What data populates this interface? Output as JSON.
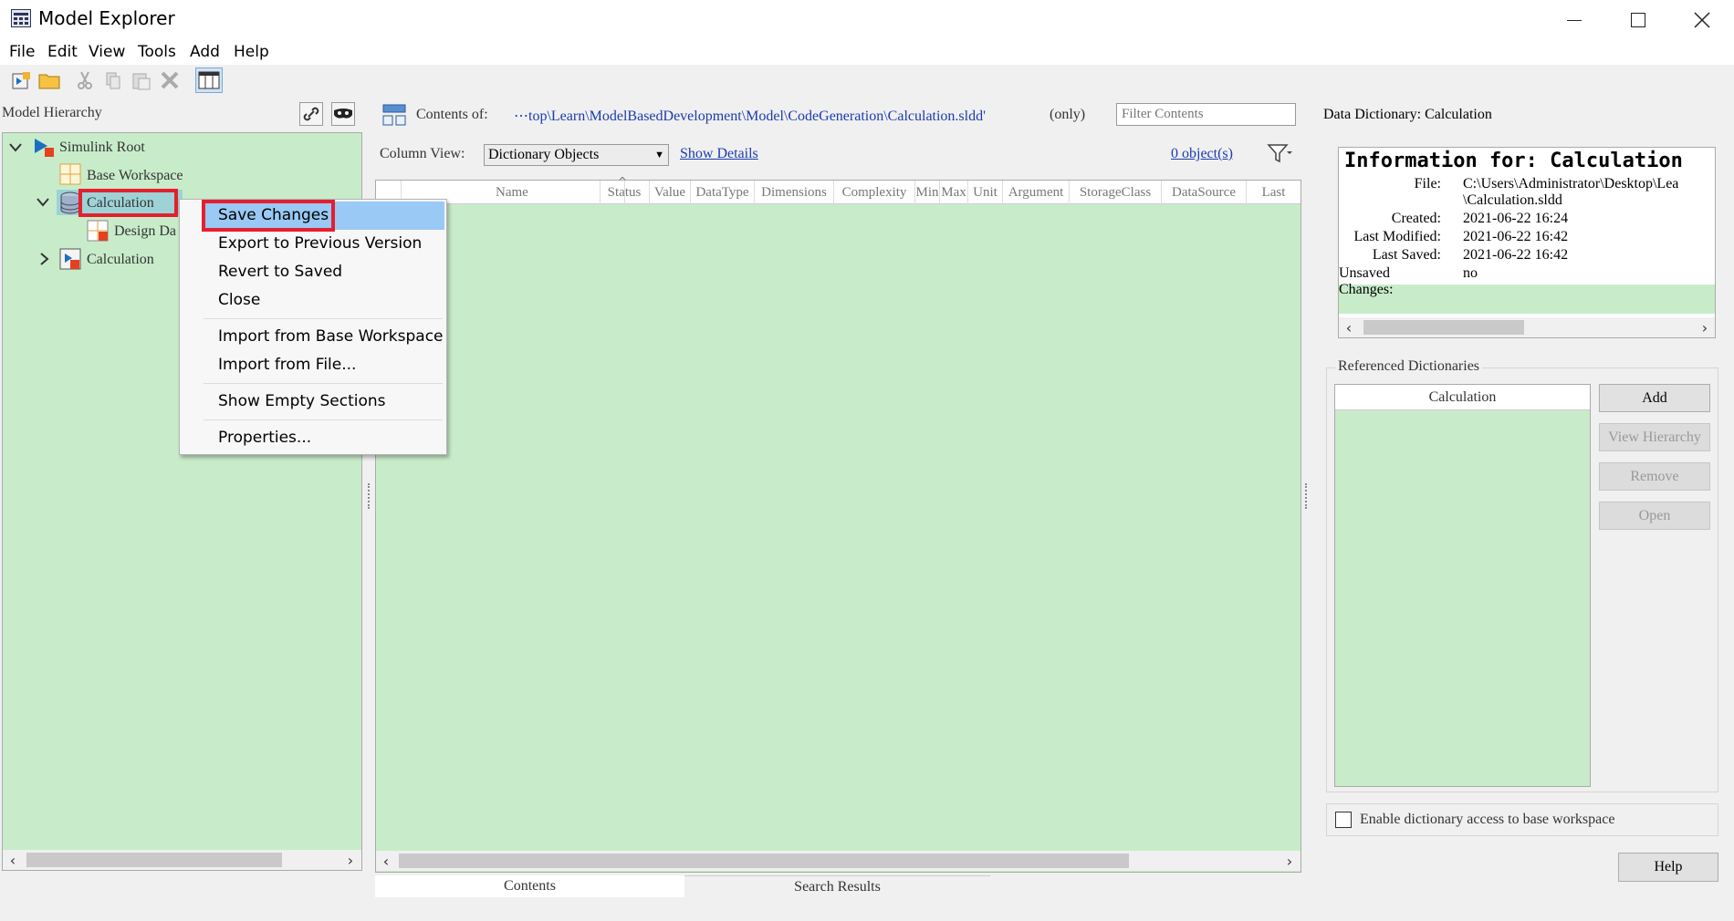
{
  "window": {
    "title": "Model Explorer"
  },
  "menu": [
    "File",
    "Edit",
    "View",
    "Tools",
    "Add",
    "Help"
  ],
  "hierarchy": {
    "title": "Model Hierarchy",
    "nodes": [
      "Simulink Root",
      "Base Workspace",
      "Calculation",
      "Design Da",
      "Calculation"
    ]
  },
  "context_menu": {
    "items": [
      "Save Changes",
      "Export to Previous Version",
      "Revert to Saved",
      "Close",
      "Import from Base Workspace",
      "Import from File...",
      "Show Empty Sections",
      "Properties..."
    ]
  },
  "contents": {
    "label": "Contents of:",
    "path": "⋯top\\Learn\\ModelBasedDevelopment\\Model\\CodeGeneration\\Calculation.sldd'",
    "only": "(only)",
    "filter_placeholder": "Filter Contents",
    "column_view_label": "Column View:",
    "column_view_value": "Dictionary Objects",
    "show_details": "Show Details",
    "object_count": "0 object(s)",
    "columns": [
      "Name",
      "Status",
      "Value",
      "DataType",
      "Dimensions",
      "Complexity",
      "Min",
      "Max",
      "Unit",
      "Argument",
      "StorageClass",
      "DataSource",
      "Last"
    ],
    "tabs": [
      "Contents",
      "Search Results"
    ]
  },
  "dictionary": {
    "header": "Data Dictionary: Calculation",
    "info_title": "Information for: Calculation",
    "fields": [
      {
        "label": "File:",
        "value": "C:\\Users\\Administrator\\Desktop\\Lea"
      },
      {
        "label": "",
        "value": "\\Calculation.sldd"
      },
      {
        "label": "Created:",
        "value": "2021-06-22 16:24"
      },
      {
        "label": "Last Modified:",
        "value": "2021-06-22 16:42"
      },
      {
        "label": "Last Saved:",
        "value": "2021-06-22 16:42"
      },
      {
        "label": "Unsaved Changes:",
        "value": "no"
      }
    ],
    "referenced_title": "Referenced Dictionaries",
    "referenced_header": "Calculation",
    "buttons": [
      "Add",
      "View Hierarchy",
      "Remove",
      "Open"
    ],
    "enable_access": "Enable dictionary access to base workspace",
    "help": "Help"
  },
  "colors": {
    "tree_bg": "#c8ecca",
    "highlight": "#e4202e",
    "menu_select": "#99c9f4"
  }
}
